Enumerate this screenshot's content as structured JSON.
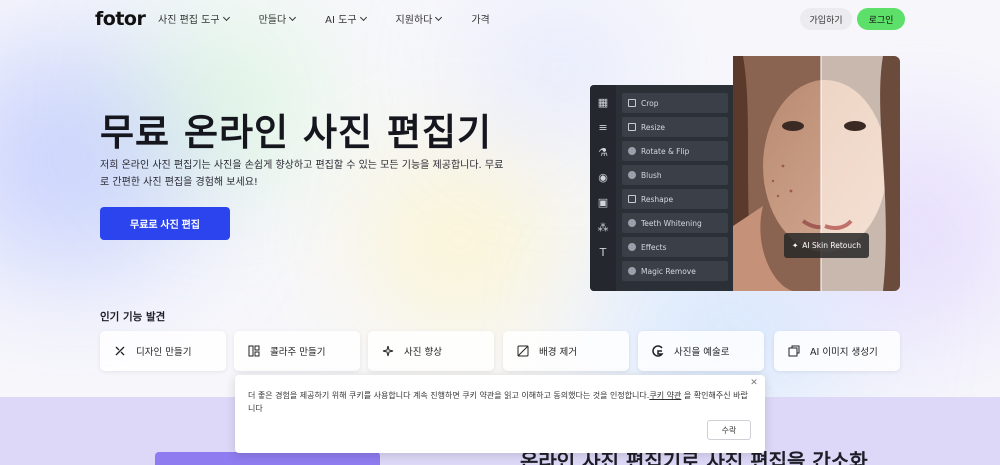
{
  "header": {
    "logo": "fotor",
    "nav": [
      {
        "label": "사진 편집 도구",
        "has_dropdown": true
      },
      {
        "label": "만들다",
        "has_dropdown": true
      },
      {
        "label": "AI 도구",
        "has_dropdown": true
      },
      {
        "label": "지원하다",
        "has_dropdown": true
      },
      {
        "label": "가격",
        "has_dropdown": false
      }
    ],
    "signup_label": "가입하기",
    "login_label": "로그인"
  },
  "hero": {
    "title": "무료 온라인 사진 편집기",
    "description": "저희 온라인 사진 편집기는 사진을 손쉽게 향상하고 편집할 수 있는 모든 기능을 제공합니다. 무료로 간편한 사진 편집을 경험해 보세요!",
    "cta_label": "무료로 사진 편집"
  },
  "editor": {
    "tools": [
      {
        "label": "Crop",
        "icon": "crop-icon"
      },
      {
        "label": "Resize",
        "icon": "resize-icon"
      },
      {
        "label": "Rotate & Flip",
        "icon": "rotate-icon"
      },
      {
        "label": "Blush",
        "icon": "blush-icon"
      },
      {
        "label": "Reshape",
        "icon": "reshape-icon"
      },
      {
        "label": "Teeth Whitening",
        "icon": "teeth-icon"
      },
      {
        "label": "Effects",
        "icon": "effects-icon"
      },
      {
        "label": "Magic Remove",
        "icon": "magic-remove-icon"
      }
    ],
    "badge_label": "AI Skin Retouch"
  },
  "features": {
    "title": "인기 기능 발견",
    "items": [
      {
        "label": "디자인 만들기",
        "icon": "design-icon"
      },
      {
        "label": "콜라주 만들기",
        "icon": "collage-icon"
      },
      {
        "label": "사진 향상",
        "icon": "enhance-icon"
      },
      {
        "label": "배경 제거",
        "icon": "background-remove-icon"
      },
      {
        "label": "사진을 예술로",
        "icon": "art-icon"
      },
      {
        "label": "AI 이미지 생성기",
        "icon": "ai-image-icon"
      }
    ]
  },
  "bottom": {
    "heading": "온라인 사진 편집기로 사진 편집을 간소화"
  },
  "cookie": {
    "text_before": "더 좋은 경험을 제공하기 위해 쿠키를 사용합니다 계속 진행하면 쿠키 약관을 읽고 이해하고 동의했다는 것을 인정합니다.",
    "link_label": "쿠키 약관",
    "text_after": " 을 확인해주신 바랍니다",
    "accept_label": "수락"
  },
  "colors": {
    "cta_blue": "#2b44ee",
    "login_green": "#5ce06a",
    "bottom_purple": "#ddd8f7"
  }
}
